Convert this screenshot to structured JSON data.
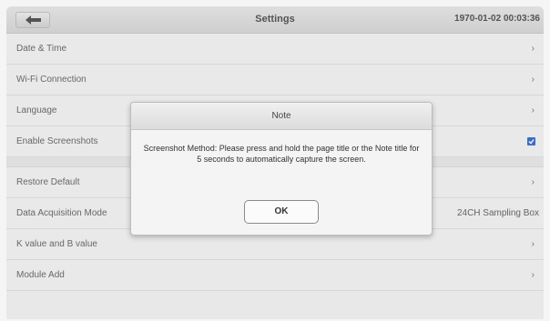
{
  "header": {
    "title": "Settings",
    "datetime": "1970-01-02 00:03:36",
    "back_icon": "back-arrow-icon"
  },
  "settings": {
    "date_time": "Date & Time",
    "wifi": "Wi-Fi Connection",
    "language": "Language",
    "enable_screenshots": "Enable Screenshots",
    "restore_default": "Restore Default",
    "data_acquisition_mode": "Data Acquisition Mode",
    "data_acquisition_value": "24CH Sampling Box",
    "k_b_value": "K value and B value",
    "module_add": "Module Add",
    "chevron": "›",
    "screenshots_enabled": true
  },
  "dialog": {
    "title": "Note",
    "message": "Screenshot Method: Please press and hold the page title or the Note title for 5 seconds to automatically capture the screen.",
    "ok_label": "OK"
  },
  "colors": {
    "checkbox": "#3e6fcf",
    "background": "#f2f2f2"
  }
}
